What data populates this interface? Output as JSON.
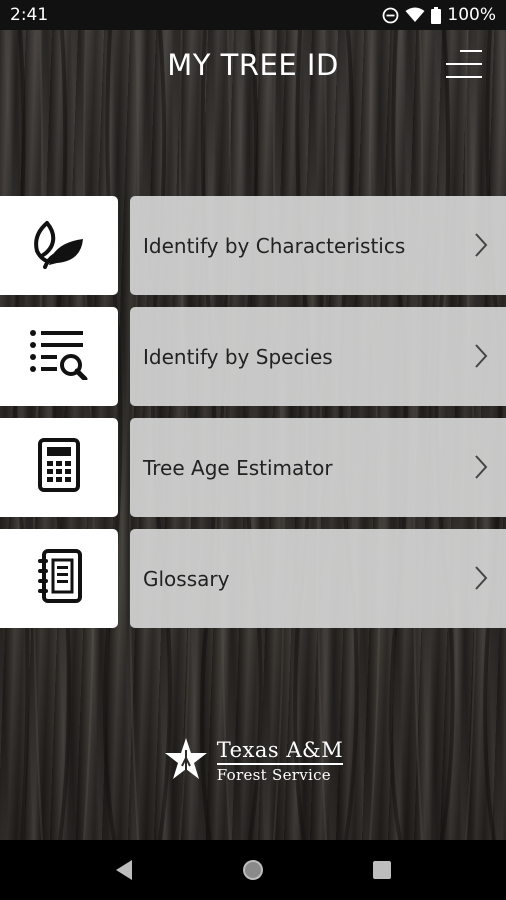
{
  "status_bar": {
    "time": "2:41",
    "battery": "100%",
    "icons": [
      "do-not-disturb-icon",
      "wifi-icon",
      "battery-icon"
    ]
  },
  "header": {
    "title": "MY TREE ID",
    "menu_icon": "hamburger-menu-icon"
  },
  "menu": {
    "items": [
      {
        "label": "Identify by Characteristics",
        "icon": "leaf-icon"
      },
      {
        "label": "Identify by Species",
        "icon": "list-search-icon"
      },
      {
        "label": "Tree Age Estimator",
        "icon": "calculator-icon"
      },
      {
        "label": "Glossary",
        "icon": "notebook-icon"
      }
    ],
    "chevron_icon": "chevron-right-icon"
  },
  "logo": {
    "line1": "Texas A&M",
    "line2": "Forest Service"
  },
  "colors": {
    "status_bar_bg": "#111111",
    "nav_bar_bg": "#000000",
    "icon_box_bg": "#ffffff",
    "label_box_bg": "#d6d6d6",
    "text_light": "#ffffff",
    "text_dark": "#222222"
  },
  "nav_bar": {
    "buttons": [
      "back-icon",
      "home-icon",
      "recents-icon"
    ]
  }
}
